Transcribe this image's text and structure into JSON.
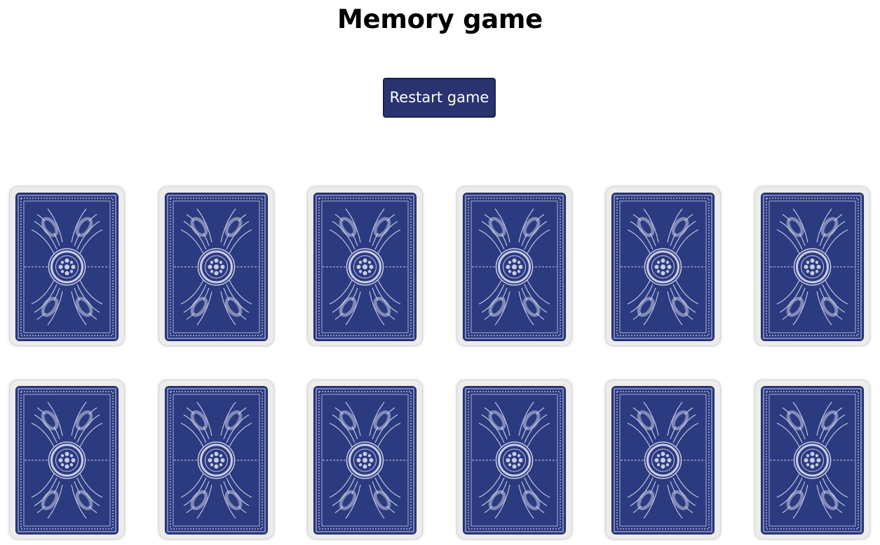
{
  "game": {
    "title": "Memory game",
    "restart_label": "Restart game"
  },
  "colors": {
    "card_back": "#2c3a80",
    "card_pattern": "#c9cde6",
    "button_bg": "#293370",
    "card_frame": "#ececec"
  },
  "board": {
    "rows": 2,
    "columns": 6,
    "cards": [
      {
        "state": "face-down"
      },
      {
        "state": "face-down"
      },
      {
        "state": "face-down"
      },
      {
        "state": "face-down"
      },
      {
        "state": "face-down"
      },
      {
        "state": "face-down"
      },
      {
        "state": "face-down"
      },
      {
        "state": "face-down"
      },
      {
        "state": "face-down"
      },
      {
        "state": "face-down"
      },
      {
        "state": "face-down"
      },
      {
        "state": "face-down"
      }
    ]
  }
}
